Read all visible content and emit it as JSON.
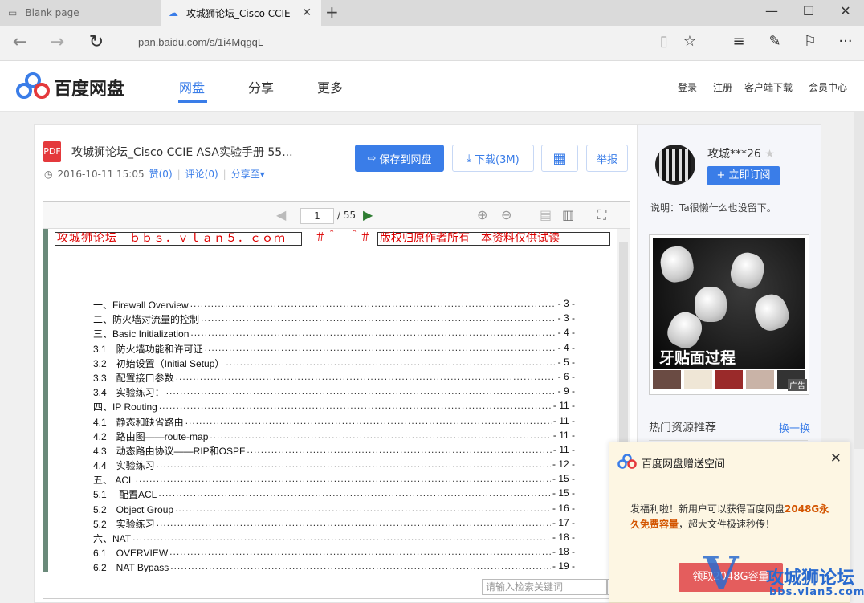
{
  "browser": {
    "tabs": [
      {
        "label": "Blank page"
      },
      {
        "label": "攻城狮论坛_Cisco CCIE"
      }
    ],
    "close_glyph": "✕",
    "new_tab_glyph": "+",
    "url": "pan.baidu.com/s/1i4MqgqL",
    "window_controls": {
      "minimize": "—",
      "maximize": "☐",
      "close": "✕"
    },
    "nav_icons": {
      "back": "←",
      "forward": "→",
      "refresh": "↻"
    },
    "toolbar_icons": {
      "reading": "▯",
      "favorite": "☆",
      "hub": "≡",
      "note": "✎",
      "share": "⚐",
      "more": "···"
    }
  },
  "site": {
    "logo_text": "百度网盘",
    "nav": [
      "网盘",
      "分享",
      "更多"
    ],
    "right_links": [
      "登录",
      "注册",
      "客户端下载",
      "会员中心"
    ]
  },
  "file": {
    "icon_label": "PDF",
    "title": "攻城狮论坛_Cisco CCIE ASA实验手册 55...",
    "date": "2016-10-11 15:05",
    "like": "赞(0)",
    "comment": "评论(0)",
    "share": "分享至",
    "separator": "|",
    "caret": "▾",
    "clock_glyph": "◷",
    "buttons": {
      "save": "保存到网盘",
      "download": "下载(3M)",
      "qr": "▦",
      "report": "举报"
    },
    "save_glyph": "⇨",
    "download_glyph": "⤓"
  },
  "viewer": {
    "page": "1",
    "total": "/ 55",
    "prev_glyph": "◀",
    "next_glyph": "▶",
    "zoom_in_glyph": "⊕",
    "zoom_out_glyph": "⊖",
    "single_page_glyph": "▤",
    "double_page_glyph": "▥",
    "fullscreen_glyph": "⛶",
    "header_left": "攻城狮论坛　ｂｂｓ．ｖｌａｎ５．ｃｏｍ",
    "header_mid": "＃＾＿＾＃",
    "header_right": "版权归原作者所有　本资料仅供试读",
    "search_placeholder": "请输入检索关键词",
    "search_glyph": "⌕",
    "toc": [
      {
        "t": "一、Firewall Overview",
        "p": "- 3 -"
      },
      {
        "t": "二、防火墙对流量的控制",
        "p": "- 3 -"
      },
      {
        "t": "三、Basic Initialization",
        "p": "- 4 -"
      },
      {
        "t": "3.1　防火墙功能和许可证",
        "p": "- 4 -"
      },
      {
        "t": "3.2　初始设置（Initial Setup）",
        "p": "- 5 -"
      },
      {
        "t": "3.3　配置接口参数",
        "p": "- 6 -"
      },
      {
        "t": "3.4　实验练习：",
        "p": "- 9 -"
      },
      {
        "t": "四、IP Routing",
        "p": "- 11 -"
      },
      {
        "t": "4.1　静态和缺省路由",
        "p": "- 11 -"
      },
      {
        "t": "4.2　路由图——route-map",
        "p": "- 11 -"
      },
      {
        "t": "4.3　动态路由协议——RIP和OSPF",
        "p": "- 11 -"
      },
      {
        "t": "4.4　实验练习",
        "p": "- 12 -"
      },
      {
        "t": "五、 ACL",
        "p": "- 15 -"
      },
      {
        "t": "5.1　 配置ACL",
        "p": "- 15 -"
      },
      {
        "t": "5.2　Object Group",
        "p": "- 16 -"
      },
      {
        "t": "5.2　实验练习",
        "p": "- 17 -"
      },
      {
        "t": "六、NAT",
        "p": "- 18 -"
      },
      {
        "t": "6.1　OVERVIEW",
        "p": "- 18 -"
      },
      {
        "t": "6.2　NAT Bypass",
        "p": "- 19 -"
      }
    ]
  },
  "sidebar": {
    "username": "攻城***26",
    "badge_glyph": "★",
    "subscribe": "+ 立即订阅",
    "desc": "说明：Ta很懒什么也没留下。",
    "ad_caption": "牙贴面过程",
    "ad_label": "广告",
    "hot_title": "热门资源推荐",
    "hot_change": "换一换"
  },
  "popup": {
    "title": "百度网盘赠送空间",
    "close_glyph": "✕",
    "text_a": "发福利啦！新用户可以获得百度网盘",
    "text_b": "2048G永久免费容量",
    "text_c": "，超大文件极速秒传！",
    "button": "领取2048G容量"
  },
  "watermark": {
    "mark": "V",
    "text": "攻城狮论坛",
    "url": "bbs.vlan5.com"
  },
  "colors": {
    "accent": "#3a7de8",
    "red": "#e4393c"
  }
}
